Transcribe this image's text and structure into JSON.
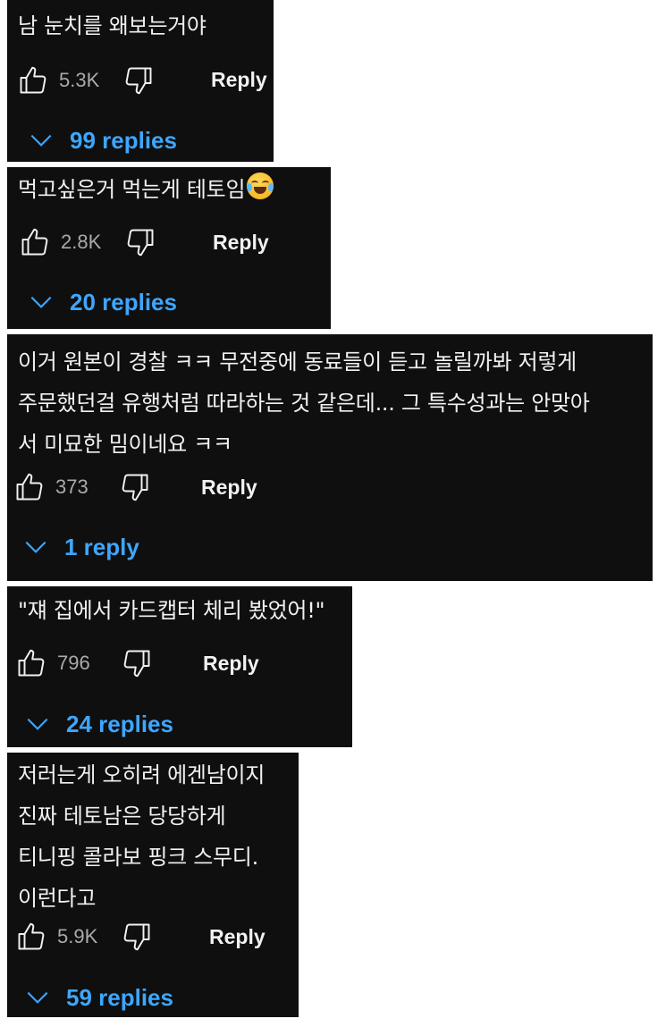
{
  "colors": {
    "card_background": "#0f0f0f",
    "text_primary": "#f1f1f1",
    "text_secondary": "#aaaaaa",
    "replies_accent": "#3ea6ff"
  },
  "icons": {
    "like": "thumbs-up-outline",
    "dislike": "thumbs-down-outline",
    "expand": "chevron-down",
    "emoji": "face-with-tears-of-joy"
  },
  "comments": [
    {
      "text": "남 눈치를 왜보는거야",
      "likes": "5.3K",
      "reply_label": "Reply",
      "replies_label": "99 replies"
    },
    {
      "text": "먹고싶은거 먹는게 테토임",
      "emoji": "😂",
      "likes": "2.8K",
      "reply_label": "Reply",
      "replies_label": "20 replies"
    },
    {
      "text": "이거 원본이 경찰 ㅋㅋ 무전중에 동료들이 듣고 놀릴까봐 저렇게\n주문했던걸 유행처럼 따라하는 것 같은데... 그 특수성과는 안맞아\n서 미묘한 밈이네요 ㅋㅋ",
      "likes": "373",
      "reply_label": "Reply",
      "replies_label": "1 reply"
    },
    {
      "text": "\"쟤 집에서 카드캡터 체리 봤었어!\"",
      "likes": "796",
      "reply_label": "Reply",
      "replies_label": "24 replies"
    },
    {
      "text": "저러는게 오히려 에겐남이지\n진짜 테토남은 당당하게\n티니핑 콜라보 핑크 스무디.\n이런다고",
      "likes": "5.9K",
      "reply_label": "Reply",
      "replies_label": "59 replies"
    }
  ]
}
